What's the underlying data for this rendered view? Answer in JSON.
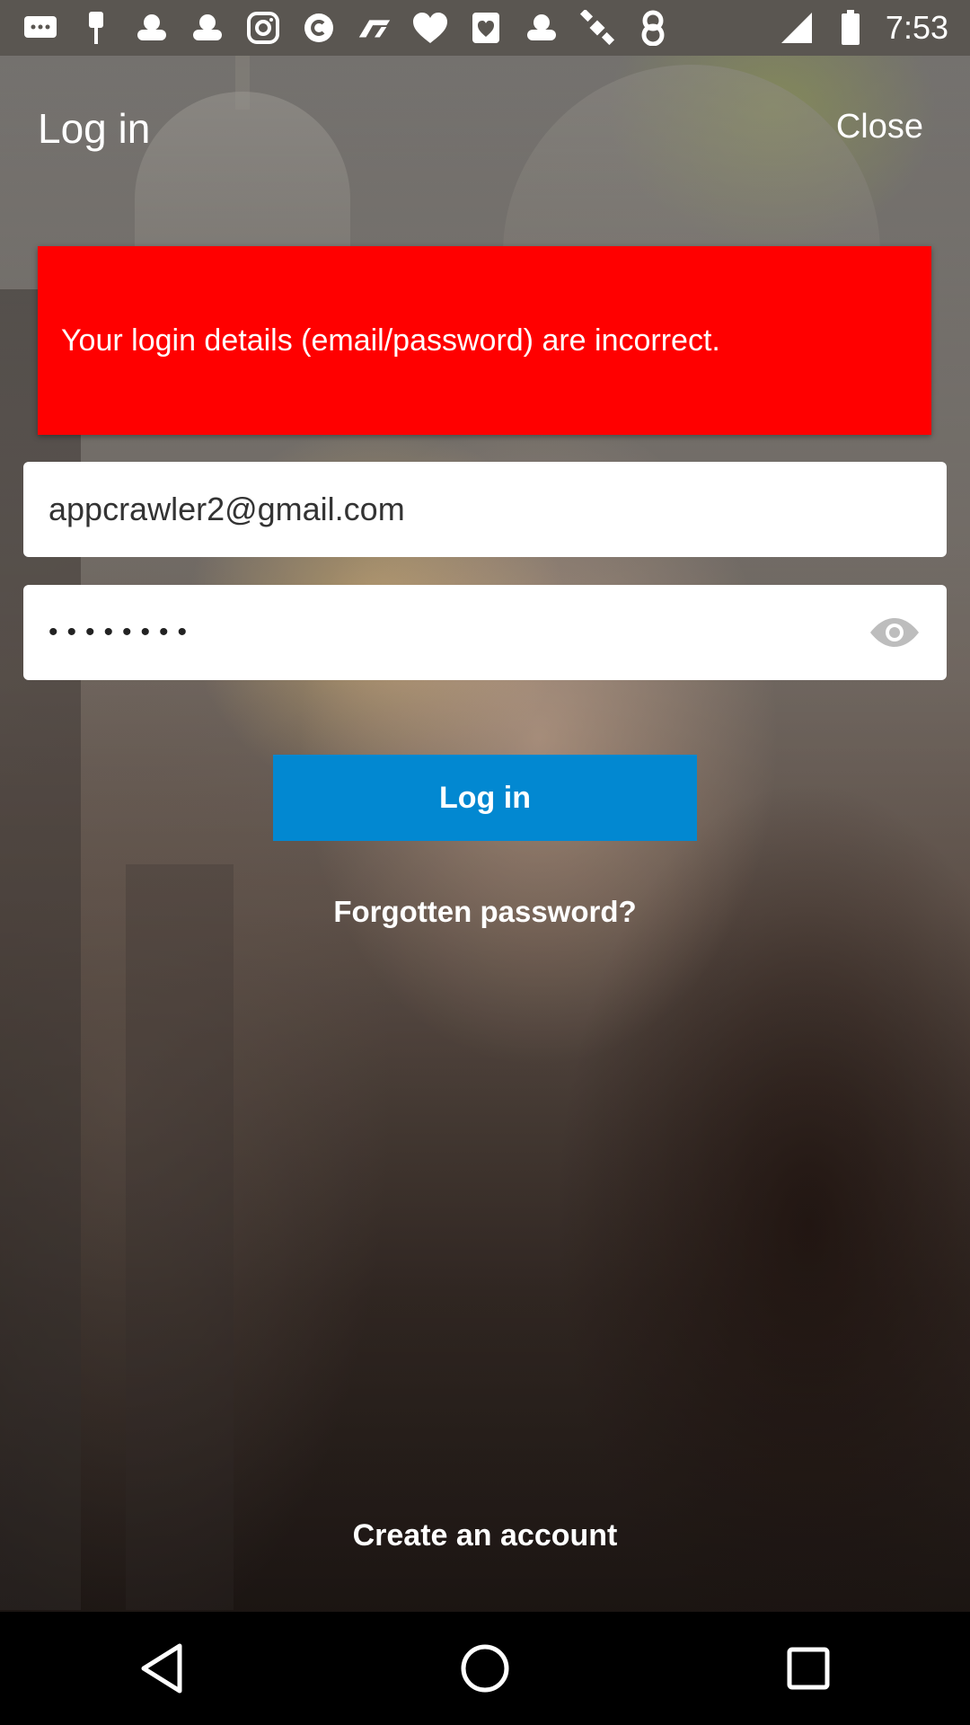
{
  "status_bar": {
    "time": "7:53",
    "icons": [
      "messages-icon",
      "pin-icon",
      "game-controller-icon",
      "game-controller-icon",
      "instagram-icon",
      "cast-c-icon",
      "f1-icon",
      "heart-icon",
      "shield-heart-icon",
      "game-controller-icon",
      "satellite-icon",
      "eight-ball-icon"
    ]
  },
  "header": {
    "title": "Log in",
    "close_label": "Close"
  },
  "error": {
    "message": "Your login details (email/password) are incorrect.",
    "color": "#ff0000"
  },
  "form": {
    "email_value": "appcrawler2@gmail.com",
    "password_value": "••••••••"
  },
  "actions": {
    "login_label": "Log in",
    "forgot_label": "Forgotten password?",
    "create_label": "Create an account",
    "accent_color": "#0288d1"
  },
  "nav": {
    "back": "back-icon",
    "home": "home-icon",
    "recents": "recents-icon"
  }
}
